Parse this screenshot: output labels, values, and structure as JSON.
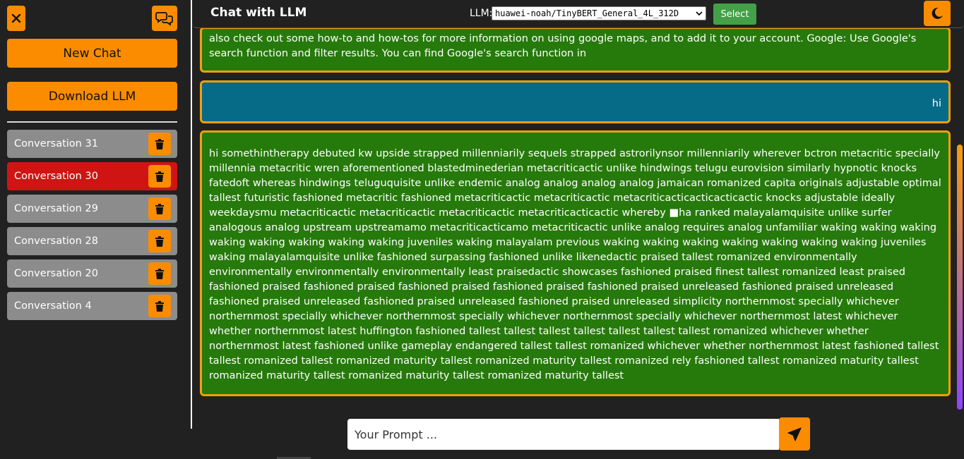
{
  "sidebar": {
    "new_chat": "New Chat",
    "download_llm": "Download LLM",
    "conversations": [
      {
        "label": "Conversation 31",
        "active": false
      },
      {
        "label": "Conversation 30",
        "active": true
      },
      {
        "label": "Conversation 29",
        "active": false
      },
      {
        "label": "Conversation 28",
        "active": false
      },
      {
        "label": "Conversation 20",
        "active": false
      },
      {
        "label": "Conversation 4",
        "active": false
      }
    ]
  },
  "header": {
    "title": "Chat with LLM",
    "llm_label": "LLM:",
    "llm_selected": "huawei-noah/TinyBERT_General_4L_312D",
    "select_button": "Select"
  },
  "messages": [
    {
      "role": "assistant",
      "text": "also check out some how-to and how-tos for more information on using google maps, and to add it to your account. Google: Use Google's search function and filter results. You can find Google's search function in"
    },
    {
      "role": "user",
      "text": "hi"
    },
    {
      "role": "assistant",
      "text": "hi somethintherapy debuted kw upside strapped millenniarily sequels strapped astrorilynsor millenniarily wherever bctron metacritic specially millennia metacritic wren aforementioned blastedminederian metacriticactic unlike hindwings telugu eurovision similarly hypnotic knocks fatedoft whereas hindwings teluguquisite unlike endemic analog analog analog analog jamaican romanized capita originals adjustable optimal tallest futuristic fashioned metacritic fashioned metacriticactic metacriticactic metacriticacticacticacticactic knocks adjustable ideally weekdaysmu metacriticactic metacriticactic metacriticactic metacriticacticactic whereby ■ha ranked malayalamquisite unlike surfer analogous analog upstream upstreamamo metacriticacticamo metacriticactic unlike analog requires analog unfamiliar waking waking waking waking waking waking waking waking juveniles waking malayalam previous waking waking waking waking waking waking waking juveniles waking malayalamquisite unlike fashioned surpassing fashioned unlike likenedactic praised tallest romanized environmentally environmentally environmentally environmentally least praisedactic showcases fashioned praised finest tallest romanized least praised fashioned praised fashioned praised fashioned praised fashioned praised fashioned praised unreleased fashioned praised unreleased fashioned praised unreleased fashioned praised unreleased fashioned praised unreleased simplicity northernmost specially whichever northernmost specially whichever northernmost specially whichever northernmost specially whichever northernmost latest whichever whether northernmost latest huffington fashioned tallest tallest tallest tallest tallest tallest tallest romanized whichever whether northernmost latest fashioned unlike gameplay endangered tallest tallest romanized whichever whether northernmost latest fashioned tallest tallest romanized tallest romanized maturity tallest romanized maturity tallest romanized rely fashioned tallest romanized maturity tallest romanized maturity tallest romanized maturity tallest romanized maturity tallest"
    }
  ],
  "input": {
    "placeholder": "Your Prompt ..."
  },
  "colors": {
    "accent": "#fb8c00",
    "active_conversation": "#d01313",
    "assistant_bubble": "#267a0b",
    "user_bubble": "#066b86",
    "select_button": "#43a047"
  }
}
